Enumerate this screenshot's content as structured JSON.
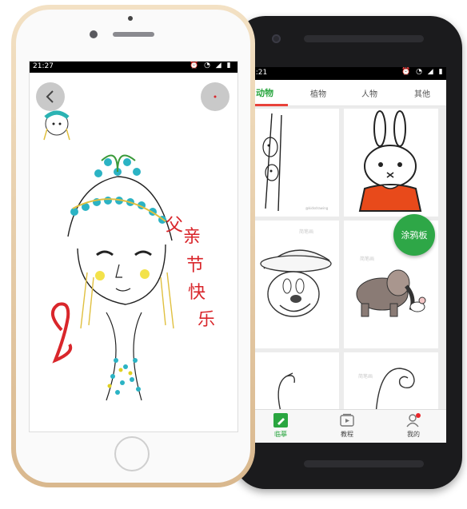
{
  "android": {
    "status_time": "1:21",
    "tabs": [
      "动物",
      "植物",
      "人物",
      "其他"
    ],
    "fab_label": "涂鸦板",
    "nav": [
      {
        "label": "临摹",
        "icon": "pencil-icon"
      },
      {
        "label": "教程",
        "icon": "video-icon"
      },
      {
        "label": "我的",
        "icon": "user-icon"
      }
    ],
    "cards": [
      "giraffe-sketch",
      "miffy-rabbit",
      "mickey-mouse-sketch",
      "elephant-mouse",
      "flamingo-sketch",
      "snail-sketch"
    ]
  },
  "iphone": {
    "status_time": "21:27",
    "back_icon": "chevron-left-icon",
    "greeting_text": "父亲节快乐",
    "colors": {
      "accent": "#2aa640",
      "tab_indicator": "#e8423a",
      "fab": "#2ea747"
    }
  }
}
